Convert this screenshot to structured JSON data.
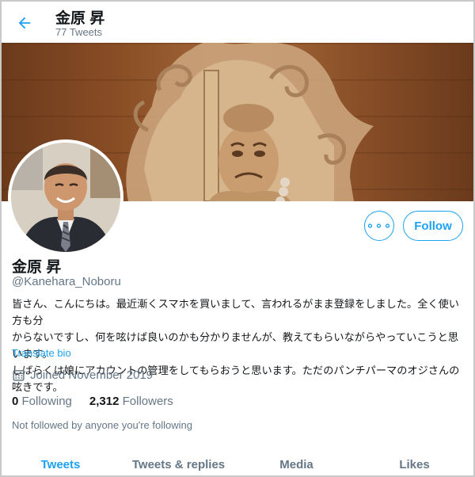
{
  "header": {
    "back_icon": "back-arrow-icon",
    "name": "金原 昇",
    "tweet_count": "77 Tweets"
  },
  "colors": {
    "accent": "#1da1f2",
    "secondary_text": "#657786"
  },
  "profile": {
    "name": "金原 昇",
    "handle": "@Kanehara_Noboru",
    "bio": "皆さん、こんにちは。最近漸くスマホを買いまして、言われるがまま登録をしました。全く使い方も分\nからないですし、何を呟けば良いのかも分かりませんが、教えてもらいながらやっていこうと思います。\nしばらくは娘にアカウントの管理をしてもらおうと思います。ただのパンチパーマのオジさんの呟きです。",
    "translate_label": "Translate bio",
    "joined": "Joined November 2019",
    "following_count": "0",
    "following_label": "Following",
    "followers_count": "2,312",
    "followers_label": "Followers",
    "not_followed": "Not followed by anyone you're following"
  },
  "actions": {
    "more_label": "∘∘∘",
    "follow_label": "Follow"
  },
  "tabs": [
    {
      "label": "Tweets",
      "active": true
    },
    {
      "label": "Tweets & replies",
      "active": false
    },
    {
      "label": "Media",
      "active": false
    },
    {
      "label": "Likes",
      "active": false
    }
  ]
}
